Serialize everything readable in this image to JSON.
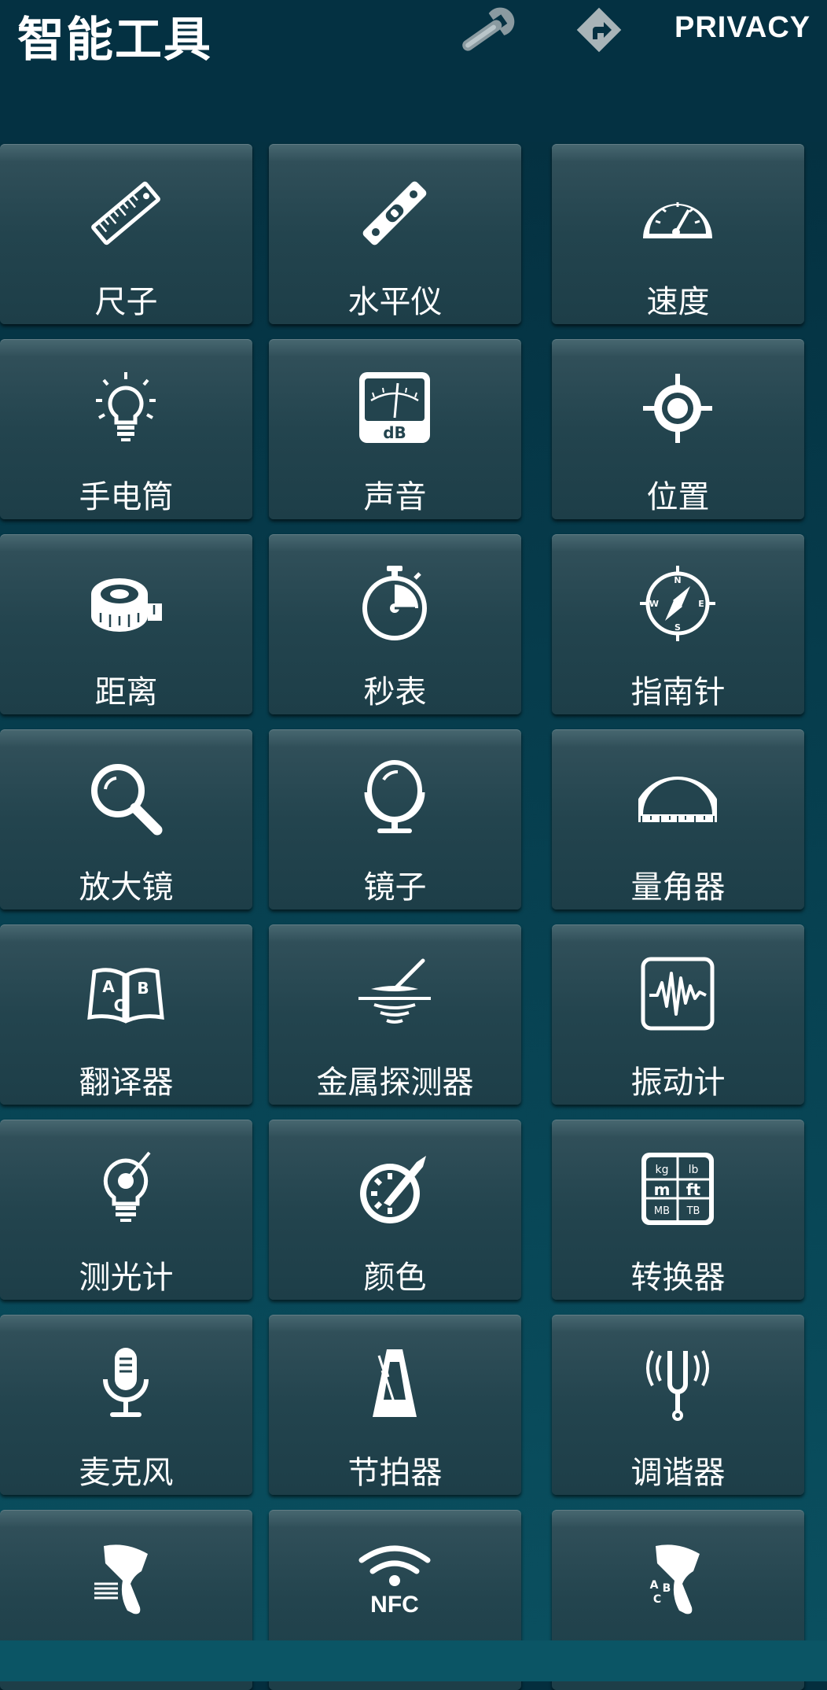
{
  "header": {
    "title": "智能工具",
    "wrench_icon": "wrench-icon",
    "direction_icon": "direction-sign-icon",
    "privacy_label": "PRIVACY"
  },
  "tools": [
    {
      "label": "尺子",
      "icon": "ruler-icon"
    },
    {
      "label": "水平仪",
      "icon": "spirit-level-icon"
    },
    {
      "label": "速度",
      "icon": "speedometer-icon"
    },
    {
      "label": "手电筒",
      "icon": "flashlight-bulb-icon"
    },
    {
      "label": "声音",
      "icon": "sound-meter-icon"
    },
    {
      "label": "位置",
      "icon": "location-target-icon"
    },
    {
      "label": "距离",
      "icon": "tape-measure-icon"
    },
    {
      "label": "秒表",
      "icon": "stopwatch-icon"
    },
    {
      "label": "指南针",
      "icon": "compass-icon"
    },
    {
      "label": "放大镜",
      "icon": "magnifier-icon"
    },
    {
      "label": "镜子",
      "icon": "mirror-icon"
    },
    {
      "label": "量角器",
      "icon": "protractor-icon"
    },
    {
      "label": "翻译器",
      "icon": "translator-book-icon"
    },
    {
      "label": "金属探测器",
      "icon": "metal-detector-icon"
    },
    {
      "label": "振动计",
      "icon": "vibration-meter-icon"
    },
    {
      "label": "测光计",
      "icon": "light-meter-icon"
    },
    {
      "label": "颜色",
      "icon": "color-picker-icon"
    },
    {
      "label": "转换器",
      "icon": "unit-converter-icon"
    },
    {
      "label": "麦克风",
      "icon": "microphone-icon"
    },
    {
      "label": "节拍器",
      "icon": "metronome-icon"
    },
    {
      "label": "调谐器",
      "icon": "tuning-fork-icon"
    },
    {
      "label": "",
      "icon": "barcode-scanner-icon"
    },
    {
      "label": "",
      "icon": "nfc-icon"
    },
    {
      "label": "",
      "icon": "text-scanner-icon"
    }
  ],
  "icon_text": {
    "sound_unit": "dB",
    "compass": [
      "N",
      "E",
      "S",
      "W"
    ],
    "book": [
      "A",
      "B",
      "C"
    ],
    "converter": [
      "kg",
      "lb",
      "m",
      "ft",
      "MB",
      "TB"
    ],
    "nfc": "NFC",
    "scanner_abc": [
      "A",
      "B",
      "C"
    ]
  },
  "colors": {
    "background": "#063c4c",
    "tile": "#23444e",
    "icon": "#ffffff"
  }
}
